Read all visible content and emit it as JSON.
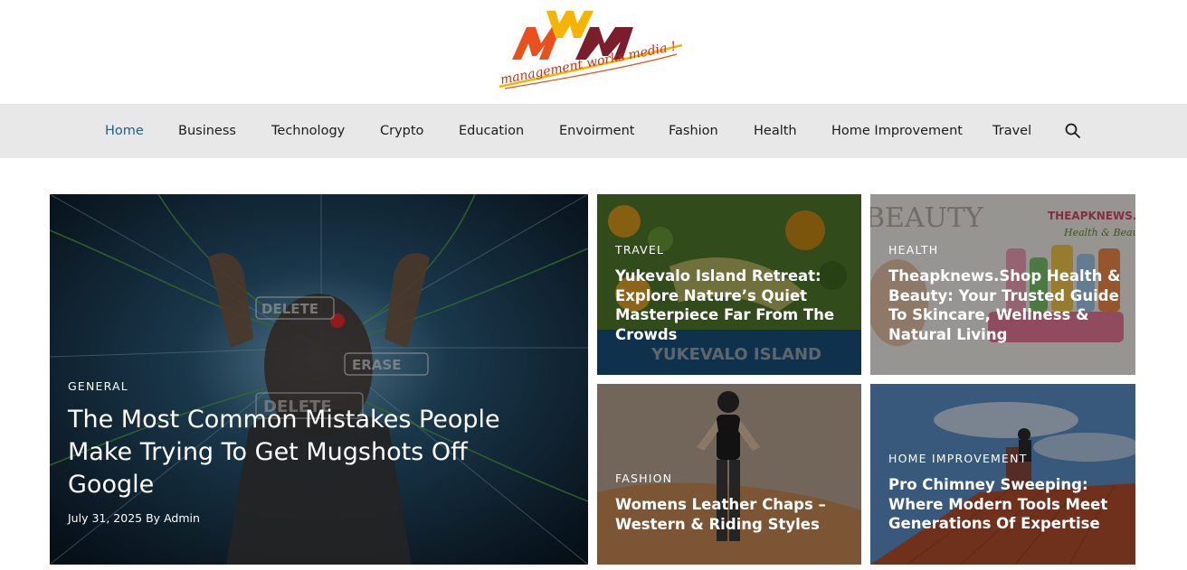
{
  "logo": {
    "text": "management works media !",
    "colors": {
      "orange": "#e8501e",
      "yellow": "#f5b400",
      "maroon": "#7a1d2c"
    }
  },
  "nav": {
    "items": [
      {
        "label": "Home",
        "active": true
      },
      {
        "label": "Business"
      },
      {
        "label": "Technology"
      },
      {
        "label": "Crypto"
      },
      {
        "label": "Education"
      },
      {
        "label": "Envoirment"
      },
      {
        "label": "Fashion"
      },
      {
        "label": "Health"
      },
      {
        "label": "Home Improvement"
      },
      {
        "label": "Travel"
      }
    ],
    "search_icon": "search-icon",
    "active_color": "#1e5f8c",
    "bar_color": "#e8e8e8"
  },
  "featured": {
    "category": "GENERAL",
    "title_lines": [
      "The Most Common Mistakes People",
      "Make Trying To Get Mugshots Off",
      "Google"
    ],
    "date": "July 31, 2025",
    "author_prefix": "By",
    "author": "Admin",
    "image_words": [
      "DELETE",
      "ERASE",
      "DELETE"
    ]
  },
  "cards": [
    {
      "category": "TRAVEL",
      "title_lines": [
        "Yukevalo Island Retreat:",
        "Explore Nature’s Quiet",
        "Masterpiece Far From The",
        "Crowds"
      ],
      "image_text": "YUKEVALO ISLAND"
    },
    {
      "category": "HEALTH",
      "title_lines": [
        "Theapknews.Shop Health &",
        "Beauty: Your Trusted Guide",
        "To Skincare, Wellness &",
        "Natural Living"
      ],
      "image_text_1": "BEAUTY",
      "image_text_2": "THEAPKNEWS.S",
      "image_text_3": "Health & Beaut"
    },
    {
      "category": "FASHION",
      "title_lines": [
        "Womens Leather Chaps –",
        "Western & Riding Styles"
      ]
    },
    {
      "category": "HOME IMPROVEMENT",
      "title_lines": [
        "Pro Chimney Sweeping:",
        "Where Modern Tools Meet",
        "Generations Of Expertise"
      ]
    }
  ]
}
